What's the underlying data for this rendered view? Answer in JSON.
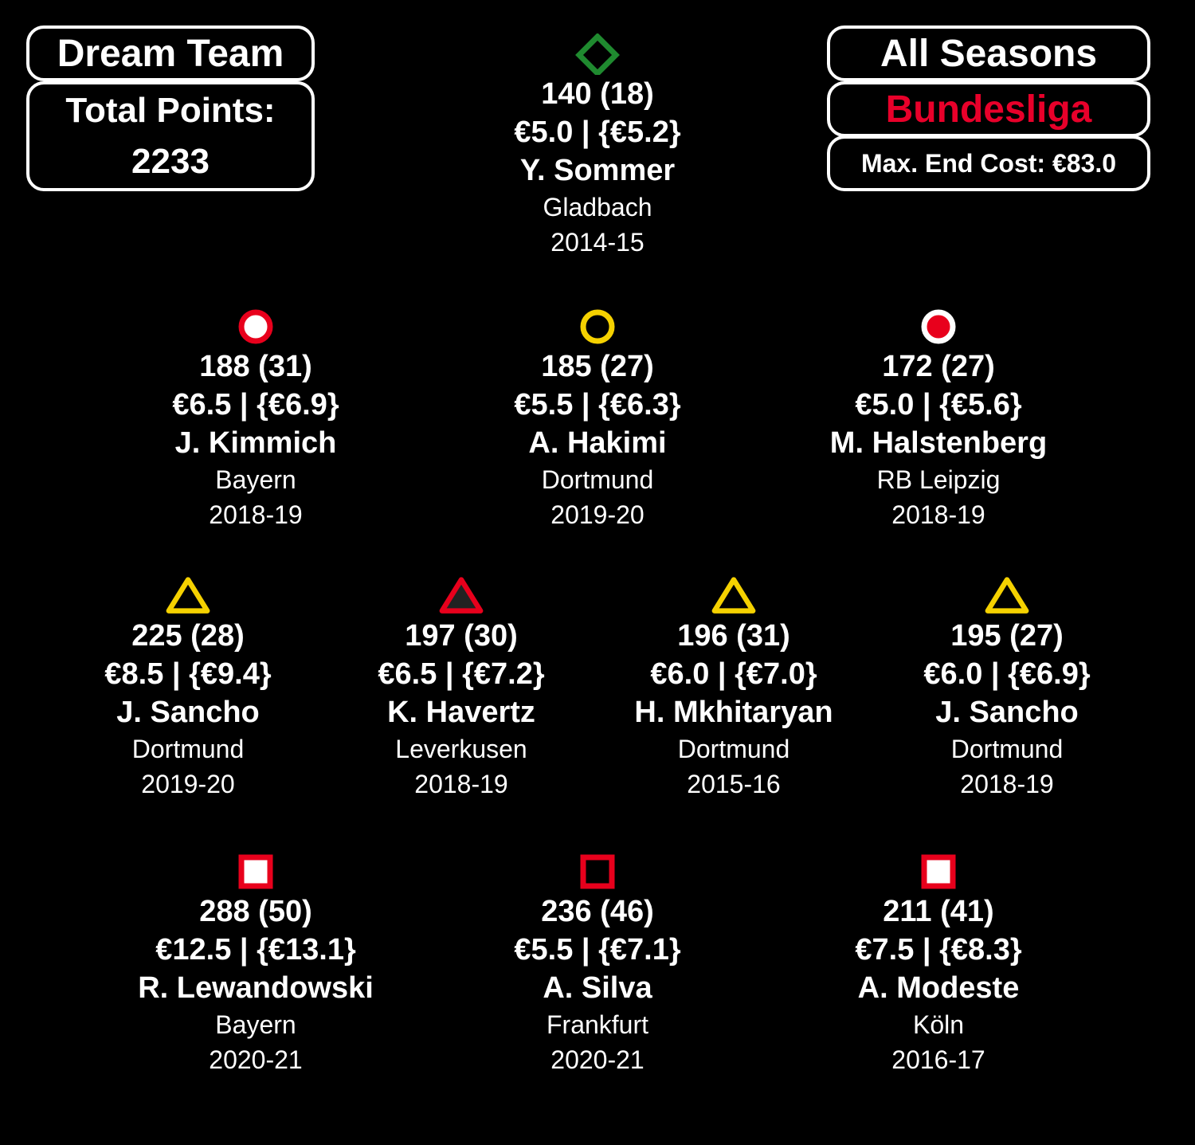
{
  "header": {
    "title": "Dream Team",
    "total_label": "Total Points:",
    "total_value": "2233",
    "seasons": "All Seasons",
    "league": "Bundesliga",
    "max_cost": "Max. End Cost: €83.0",
    "league_color": "#e8002a"
  },
  "players": [
    {
      "points": "140 (18)",
      "price": "€5.0 | {€5.2}",
      "name": "Y. Sommer",
      "team": "Gladbach",
      "season": "2014-15",
      "marker": "diamond-icon"
    },
    {
      "points": "188 (31)",
      "price": "€6.5 | {€6.9}",
      "name": "J. Kimmich",
      "team": "Bayern",
      "season": "2018-19",
      "marker": "circle-icon"
    },
    {
      "points": "185 (27)",
      "price": "€5.5 | {€6.3}",
      "name": "A. Hakimi",
      "team": "Dortmund",
      "season": "2019-20",
      "marker": "circle-icon"
    },
    {
      "points": "172 (27)",
      "price": "€5.0 | {€5.6}",
      "name": "M. Halstenberg",
      "team": "RB Leipzig",
      "season": "2018-19",
      "marker": "circle-icon"
    },
    {
      "points": "225 (28)",
      "price": "€8.5 | {€9.4}",
      "name": "J. Sancho",
      "team": "Dortmund",
      "season": "2019-20",
      "marker": "triangle-icon"
    },
    {
      "points": "197 (30)",
      "price": "€6.5 | {€7.2}",
      "name": "K. Havertz",
      "team": "Leverkusen",
      "season": "2018-19",
      "marker": "triangle-icon"
    },
    {
      "points": "196 (31)",
      "price": "€6.0 | {€7.0}",
      "name": "H. Mkhitaryan",
      "team": "Dortmund",
      "season": "2015-16",
      "marker": "triangle-icon"
    },
    {
      "points": "195 (27)",
      "price": "€6.0 | {€6.9}",
      "name": "J. Sancho",
      "team": "Dortmund",
      "season": "2018-19",
      "marker": "triangle-icon"
    },
    {
      "points": "288 (50)",
      "price": "€12.5 | {€13.1}",
      "name": "R. Lewandowski",
      "team": "Bayern",
      "season": "2020-21",
      "marker": "square-icon"
    },
    {
      "points": "236 (46)",
      "price": "€5.5 | {€7.1}",
      "name": "A. Silva",
      "team": "Frankfurt",
      "season": "2020-21",
      "marker": "square-icon"
    },
    {
      "points": "211 (41)",
      "price": "€7.5 | {€8.3}",
      "name": "A. Modeste",
      "team": "Köln",
      "season": "2016-17",
      "marker": "square-icon"
    }
  ]
}
